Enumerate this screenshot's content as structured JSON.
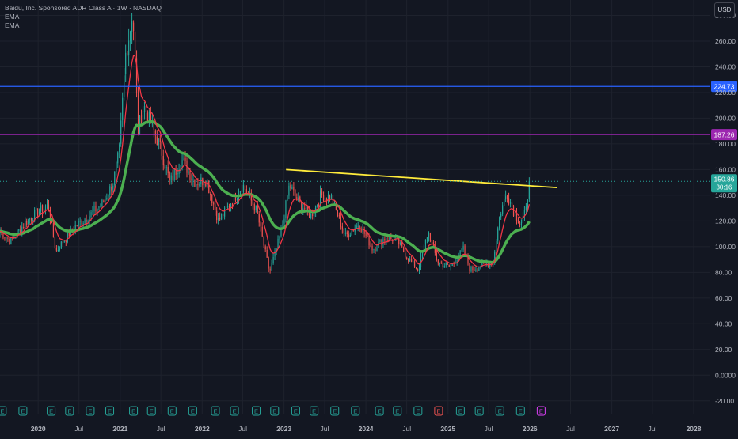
{
  "header": {
    "symbol_title": "Baidu, Inc. Sponsored ADR Class A · 1W · NASDAQ",
    "indicators": [
      "EMA",
      "EMA"
    ],
    "currency": "USD"
  },
  "chart_data": {
    "type": "candlestick",
    "title": "Baidu, Inc. Sponsored ADR Class A · 1W · NASDAQ",
    "ylim": [
      -30,
      292
    ],
    "y_ticks": [
      "280.00",
      "260.00",
      "240.00",
      "220.00",
      "200.00",
      "180.00",
      "160.00",
      "140.00",
      "120.00",
      "100.00",
      "80.00",
      "60.00",
      "40.00",
      "20.00",
      "0.0000",
      "-20.00"
    ],
    "y_tick_values": [
      280,
      260,
      240,
      220,
      200,
      180,
      160,
      140,
      120,
      100,
      80,
      60,
      40,
      20,
      0,
      -20
    ],
    "x_range": [
      "2019-07-15",
      "2028-03-15"
    ],
    "x_ticks": [
      {
        "label": "2020",
        "date": "2020-01-01"
      },
      {
        "label": "Jul",
        "date": "2020-07-01"
      },
      {
        "label": "2021",
        "date": "2021-01-01"
      },
      {
        "label": "Jul",
        "date": "2021-07-01"
      },
      {
        "label": "2022",
        "date": "2022-01-01"
      },
      {
        "label": "Jul",
        "date": "2022-07-01"
      },
      {
        "label": "2023",
        "date": "2023-01-01"
      },
      {
        "label": "Jul",
        "date": "2023-07-01"
      },
      {
        "label": "2024",
        "date": "2024-01-01"
      },
      {
        "label": "Jul",
        "date": "2024-07-01"
      },
      {
        "label": "2025",
        "date": "2025-01-01"
      },
      {
        "label": "Jul",
        "date": "2025-07-01"
      },
      {
        "label": "2026",
        "date": "2026-01-01"
      },
      {
        "label": "Jul",
        "date": "2026-07-01"
      },
      {
        "label": "2027",
        "date": "2027-01-01"
      },
      {
        "label": "Jul",
        "date": "2027-07-01"
      },
      {
        "label": "2028",
        "date": "2028-01-01"
      }
    ],
    "price_path": [
      [
        "2019-07-15",
        112
      ],
      [
        "2019-09-01",
        104
      ],
      [
        "2019-11-01",
        118
      ],
      [
        "2019-12-20",
        126
      ],
      [
        "2020-02-15",
        132
      ],
      [
        "2020-03-20",
        96
      ],
      [
        "2020-04-20",
        104
      ],
      [
        "2020-06-15",
        116
      ],
      [
        "2020-08-15",
        124
      ],
      [
        "2020-10-15",
        134
      ],
      [
        "2020-12-01",
        150
      ],
      [
        "2020-12-28",
        175
      ],
      [
        "2021-01-25",
        250
      ],
      [
        "2021-02-15",
        270
      ],
      [
        "2021-02-25",
        285
      ],
      [
        "2021-03-22",
        190
      ],
      [
        "2021-04-15",
        210
      ],
      [
        "2021-05-20",
        195
      ],
      [
        "2021-07-01",
        176
      ],
      [
        "2021-08-10",
        150
      ],
      [
        "2021-10-01",
        168
      ],
      [
        "2021-12-01",
        150
      ],
      [
        "2022-01-20",
        152
      ],
      [
        "2022-03-15",
        120
      ],
      [
        "2022-05-01",
        132
      ],
      [
        "2022-07-01",
        148
      ],
      [
        "2022-09-01",
        128
      ],
      [
        "2022-10-28",
        80
      ],
      [
        "2022-12-20",
        112
      ],
      [
        "2023-01-25",
        148
      ],
      [
        "2023-03-01",
        136
      ],
      [
        "2023-05-01",
        124
      ],
      [
        "2023-06-15",
        140
      ],
      [
        "2023-08-01",
        138
      ],
      [
        "2023-10-01",
        108
      ],
      [
        "2023-12-01",
        118
      ],
      [
        "2024-02-01",
        98
      ],
      [
        "2024-03-20",
        106
      ],
      [
        "2024-05-15",
        106
      ],
      [
        "2024-07-01",
        92
      ],
      [
        "2024-08-20",
        82
      ],
      [
        "2024-10-05",
        112
      ],
      [
        "2024-11-15",
        88
      ],
      [
        "2025-01-10",
        84
      ],
      [
        "2025-03-10",
        98
      ],
      [
        "2025-04-10",
        82
      ],
      [
        "2025-06-10",
        86
      ],
      [
        "2025-07-20",
        88
      ],
      [
        "2025-08-20",
        125
      ],
      [
        "2025-09-20",
        142
      ],
      [
        "2025-10-20",
        128
      ],
      [
        "2025-11-20",
        118
      ],
      [
        "2025-12-15",
        128
      ],
      [
        "2025-12-29",
        150.86
      ]
    ],
    "series": [
      {
        "type": "candles",
        "up_color": "#26a69a",
        "down_color": "#ef5350"
      },
      {
        "type": "ema_fast",
        "color": "#f23645"
      },
      {
        "type": "ema_slow",
        "color": "#4caf50"
      }
    ],
    "horizontal_lines": [
      {
        "value": 224.73,
        "label": "224.73",
        "color": "#2962ff"
      },
      {
        "value": 187.26,
        "label": "187.26",
        "color": "#9c27b0"
      }
    ],
    "trendline": {
      "from": [
        "2023-01-10",
        160
      ],
      "to": [
        "2026-05-01",
        146
      ],
      "color": "#ffeb3b"
    },
    "last_price": {
      "value": 150.86,
      "label": "150.86",
      "countdown": "30:16",
      "color": "#26a69a"
    },
    "earnings_markers": [
      {
        "date": "2019-07-25",
        "label": "E",
        "state": "past"
      },
      {
        "date": "2019-10-25",
        "label": "E",
        "state": "past"
      },
      {
        "date": "2020-02-28",
        "label": "E",
        "state": "past"
      },
      {
        "date": "2020-05-20",
        "label": "E",
        "state": "past"
      },
      {
        "date": "2020-08-20",
        "label": "E",
        "state": "past"
      },
      {
        "date": "2020-11-15",
        "label": "E",
        "state": "past"
      },
      {
        "date": "2021-03-01",
        "label": "E",
        "state": "past"
      },
      {
        "date": "2021-05-20",
        "label": "E",
        "state": "past"
      },
      {
        "date": "2021-08-20",
        "label": "E",
        "state": "past"
      },
      {
        "date": "2021-11-20",
        "label": "E",
        "state": "past"
      },
      {
        "date": "2022-03-01",
        "label": "E",
        "state": "past"
      },
      {
        "date": "2022-05-25",
        "label": "E",
        "state": "past"
      },
      {
        "date": "2022-08-30",
        "label": "E",
        "state": "past"
      },
      {
        "date": "2022-11-20",
        "label": "E",
        "state": "past"
      },
      {
        "date": "2023-02-22",
        "label": "E",
        "state": "past"
      },
      {
        "date": "2023-05-15",
        "label": "E",
        "state": "past"
      },
      {
        "date": "2023-08-15",
        "label": "E",
        "state": "past"
      },
      {
        "date": "2023-11-15",
        "label": "E",
        "state": "past"
      },
      {
        "date": "2024-03-01",
        "label": "E",
        "state": "past"
      },
      {
        "date": "2024-05-20",
        "label": "E",
        "state": "past"
      },
      {
        "date": "2024-08-20",
        "label": "E",
        "state": "past"
      },
      {
        "date": "2024-11-20",
        "label": "E",
        "state": "negative"
      },
      {
        "date": "2025-02-25",
        "label": "E",
        "state": "past"
      },
      {
        "date": "2025-05-20",
        "label": "E",
        "state": "past"
      },
      {
        "date": "2025-08-20",
        "label": "E",
        "state": "past"
      },
      {
        "date": "2025-11-20",
        "label": "E",
        "state": "past"
      },
      {
        "date": "2026-02-20",
        "label": "E",
        "state": "upcoming"
      }
    ],
    "grid": true,
    "colors": {
      "background": "#131722",
      "grid": "#1e222d",
      "text": "#b2b5be"
    }
  }
}
